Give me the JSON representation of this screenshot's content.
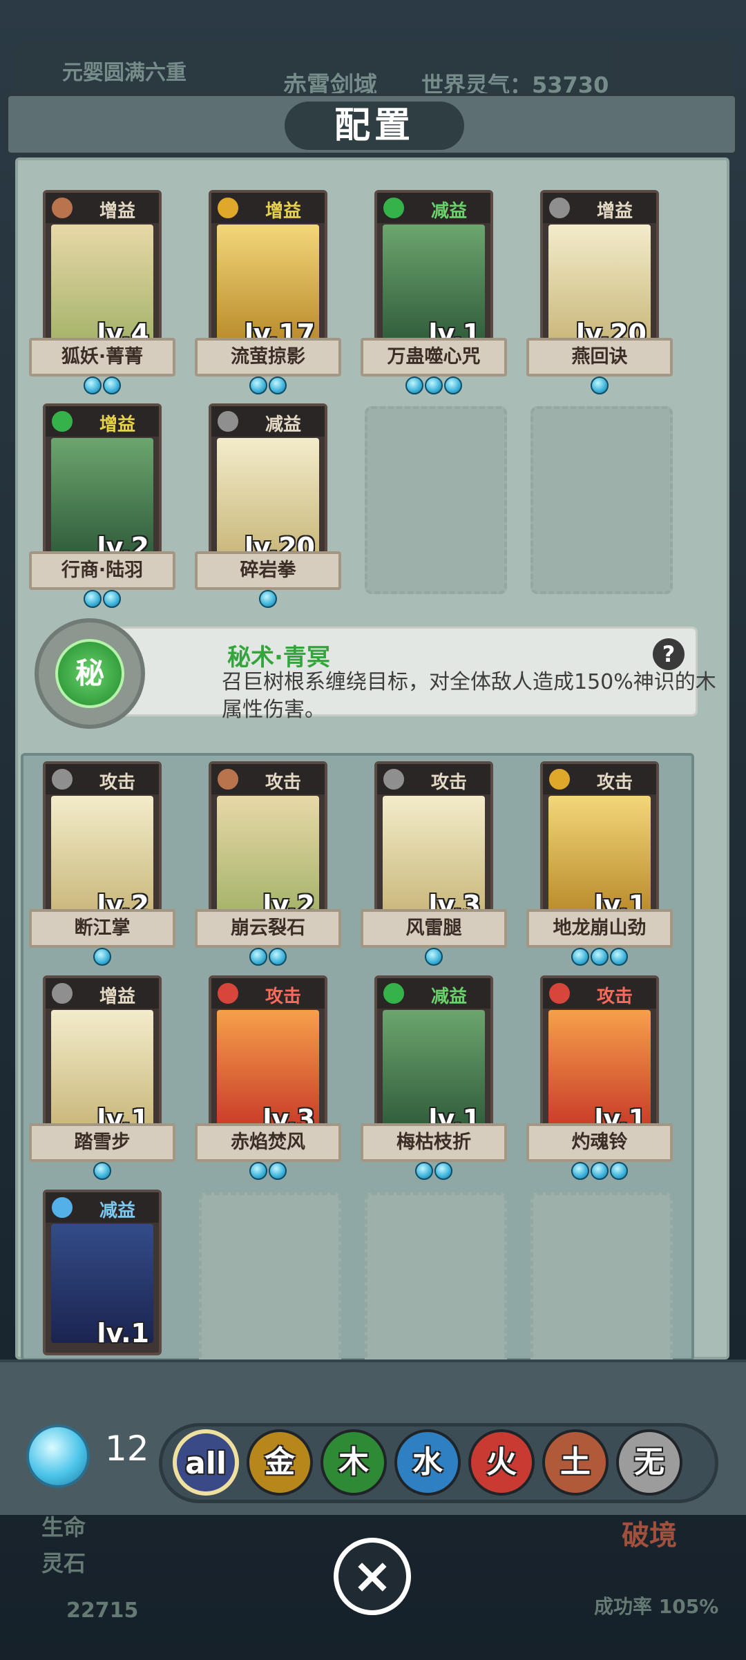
{
  "background_status": {
    "realm": "元婴圆满六重",
    "sect_name": "赤霄剑域",
    "world_qi": "世界灵气：53730",
    "stone_count": "22715",
    "breakthrough_label": "破境",
    "success_rate": "成功率 105%",
    "labels": [
      "生命",
      "灵石"
    ]
  },
  "dialog": {
    "title": "配置"
  },
  "secret": {
    "badge": "秘",
    "name": "秘术·青冥",
    "description": "召巨树根系缠绕目标，对全体敌人造成150%神识的木属性伤害。",
    "help_icon": "?"
  },
  "equipped_cards": [
    {
      "tag": "增益",
      "name": "狐妖·菁菁",
      "level": "lv.4",
      "element": "earth",
      "dots": 2,
      "tag_color": "#e4d9c4"
    },
    {
      "tag": "增益",
      "name": "流萤掠影",
      "level": "lv.17",
      "element": "metal",
      "dots": 2,
      "tag_color": "#e8d24a"
    },
    {
      "tag": "减益",
      "name": "万蛊噬心咒",
      "level": "lv.1",
      "element": "wood",
      "dots": 3,
      "tag_color": "#6ad16b"
    },
    {
      "tag": "增益",
      "name": "燕回诀",
      "level": "lv.20",
      "element": "none",
      "dots": 1,
      "tag_color": "#e4d9c4"
    },
    {
      "tag": "增益",
      "name": "行商·陆羽",
      "level": "lv.2",
      "element": "wood",
      "dots": 2,
      "tag_color": "#e8d24a"
    },
    {
      "tag": "减益",
      "name": "碎岩拳",
      "level": "lv.20",
      "element": "none",
      "dots": 1,
      "tag_color": "#e4d9c4"
    }
  ],
  "owned_cards": [
    {
      "tag": "攻击",
      "name": "断江掌",
      "level": "lv.2",
      "element": "none",
      "dots": 1,
      "tag_color": "#e4d9c4"
    },
    {
      "tag": "攻击",
      "name": "崩云裂石",
      "level": "lv.2",
      "element": "earth",
      "dots": 2,
      "tag_color": "#e4d9c4"
    },
    {
      "tag": "攻击",
      "name": "风雷腿",
      "level": "lv.3",
      "element": "none",
      "dots": 1,
      "tag_color": "#e4d9c4"
    },
    {
      "tag": "攻击",
      "name": "地龙崩山劲",
      "level": "lv.1",
      "element": "metal",
      "dots": 3,
      "tag_color": "#e4d9c4"
    },
    {
      "tag": "增益",
      "name": "踏雪步",
      "level": "lv.1",
      "element": "none",
      "dots": 1,
      "tag_color": "#e4d9c4"
    },
    {
      "tag": "攻击",
      "name": "赤焰焚风",
      "level": "lv.3",
      "element": "fire",
      "dots": 2,
      "tag_color": "#ff6b5a"
    },
    {
      "tag": "减益",
      "name": "梅枯枝折",
      "level": "lv.1",
      "element": "wood",
      "dots": 2,
      "tag_color": "#6ad16b"
    },
    {
      "tag": "攻击",
      "name": "灼魂铃",
      "level": "lv.1",
      "element": "fire",
      "dots": 3,
      "tag_color": "#ff6b5a"
    },
    {
      "tag": "减益",
      "name": "",
      "level": "lv.1",
      "element": "water",
      "dots": 0,
      "tag_color": "#7ec8f0"
    }
  ],
  "spirit_count": "12",
  "filters": [
    {
      "label": "all",
      "color": "#3a4a86",
      "selected": true
    },
    {
      "label": "金",
      "color": "#b8871b",
      "selected": false
    },
    {
      "label": "木",
      "color": "#2f8a35",
      "selected": false
    },
    {
      "label": "水",
      "color": "#2f80c2",
      "selected": false
    },
    {
      "label": "火",
      "color": "#c93a32",
      "selected": false
    },
    {
      "label": "土",
      "color": "#b05a3a",
      "selected": false
    },
    {
      "label": "无",
      "color": "#9c9c9c",
      "selected": false
    }
  ],
  "close_icon": "×"
}
